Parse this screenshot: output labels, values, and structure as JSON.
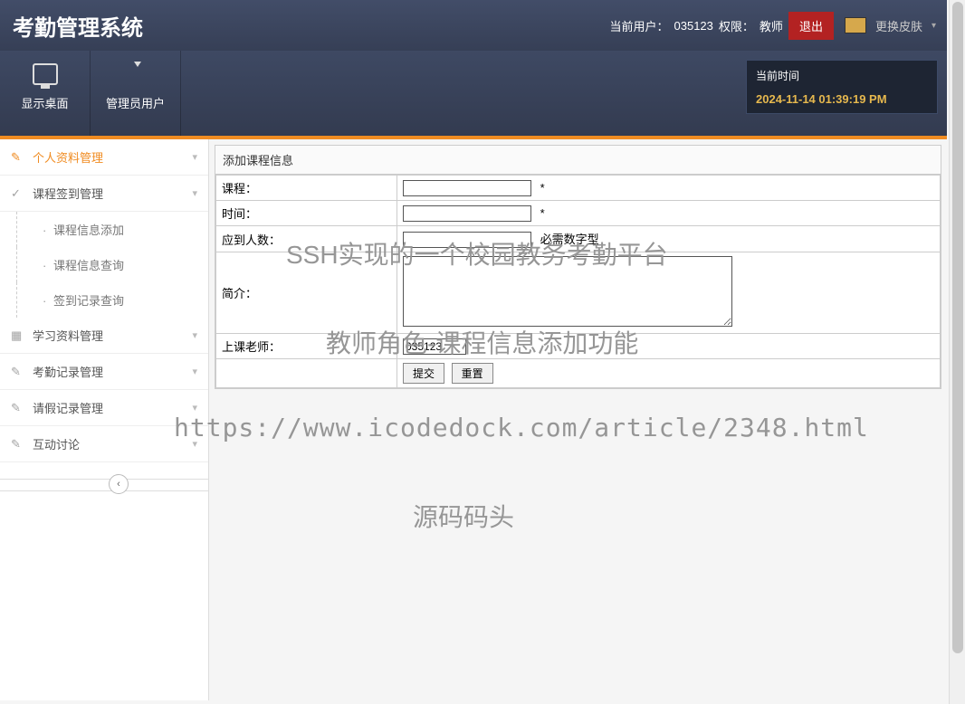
{
  "header": {
    "title": "考勤管理系统",
    "current_user_label": "当前用户：",
    "current_user_value": "035123",
    "priv_label": "权限：",
    "priv_value": "教师",
    "logout": "退出",
    "skin": "更换皮肤"
  },
  "toolbar": {
    "desktop": "显示桌面",
    "admin_user": "管理员用户"
  },
  "timebox": {
    "label": "当前时间",
    "value": "2024-11-14 01:39:19 PM"
  },
  "sidebar": {
    "cats": [
      {
        "label": "个人资料管理",
        "icon": "✎",
        "active": true,
        "subs": []
      },
      {
        "label": "课程签到管理",
        "icon": "✓",
        "active": false,
        "subs": [
          "课程信息添加",
          "课程信息查询",
          "签到记录查询"
        ]
      },
      {
        "label": "学习资料管理",
        "icon": "▦",
        "active": false,
        "subs": []
      },
      {
        "label": "考勤记录管理",
        "icon": "✎",
        "active": false,
        "subs": []
      },
      {
        "label": "请假记录管理",
        "icon": "✎",
        "active": false,
        "subs": []
      },
      {
        "label": "互动讨论",
        "icon": "✎",
        "active": false,
        "subs": []
      }
    ]
  },
  "form": {
    "panel_title": "添加课程信息",
    "rows": {
      "course": {
        "label": "课程：",
        "req": "*"
      },
      "time": {
        "label": "时间：",
        "req": "*"
      },
      "capacity": {
        "label": "应到人数：",
        "hint": "必需数字型"
      },
      "desc": {
        "label": "简介："
      },
      "teacher": {
        "label": "上课老师：",
        "value": "035123"
      }
    },
    "submit": "提交",
    "reset": "重置"
  },
  "watermarks": {
    "w1": "SSH实现的一个校园教务考勤平台",
    "w2": "教师角色-课程信息添加功能",
    "w3": "https://www.icodedock.com/article/2348.html",
    "w4": "源码码头"
  }
}
